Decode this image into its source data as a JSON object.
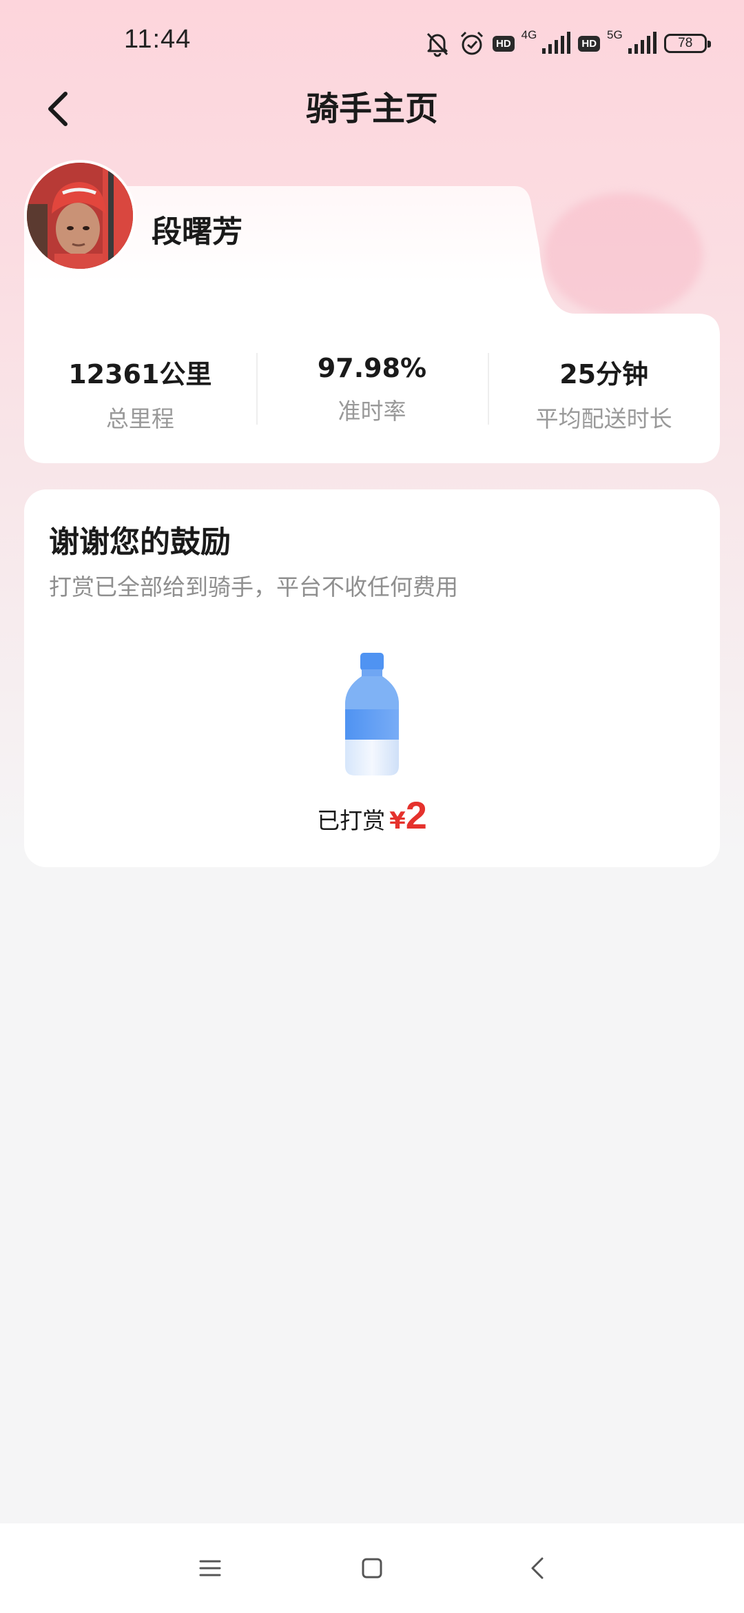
{
  "status_bar": {
    "time": "11:44",
    "network_1": "4G",
    "network_2": "5G",
    "hd_badge": "HD",
    "battery": "78",
    "icons": [
      "mute-icon",
      "alarm-icon",
      "hd-badge",
      "signal-icon",
      "hd-badge",
      "signal-icon",
      "battery-icon"
    ]
  },
  "header": {
    "title": "骑手主页",
    "back_icon": "chevron-left-icon"
  },
  "profile": {
    "name": "段曙芳",
    "avatar": "rider-avatar"
  },
  "stats": [
    {
      "value": "12361公里",
      "label": "总里程"
    },
    {
      "value": "97.98%",
      "label": "准时率"
    },
    {
      "value": "25分钟",
      "label": "平均配送时长"
    }
  ],
  "tip_card": {
    "title": "谢谢您的鼓励",
    "subtitle": "打赏已全部给到骑手，平台不收任何费用",
    "tipped_label": "已打赏",
    "currency": "¥",
    "amount": "2",
    "illustration": "water-bottle-icon"
  },
  "nav_bar": {
    "icons": [
      "menu-icon",
      "home-icon",
      "back-icon"
    ]
  },
  "colors": {
    "accent": "#e5322d",
    "header_gradient_top": "#fdd5dc",
    "page_background": "#f5f5f6",
    "muted_text": "#999999"
  }
}
